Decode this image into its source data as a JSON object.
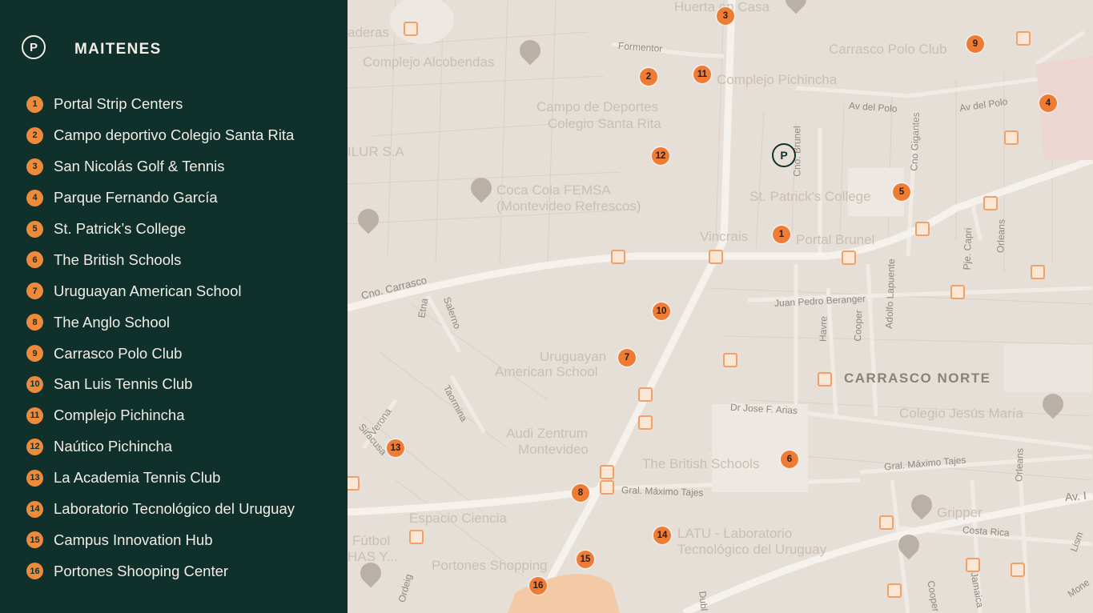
{
  "brand": {
    "logo_letter": "P",
    "name": "MAITENES"
  },
  "locations": [
    {
      "n": "1",
      "name": "Portal Strip Centers"
    },
    {
      "n": "2",
      "name": "Campo deportivo Colegio Santa Rita"
    },
    {
      "n": "3",
      "name": "San Nicolás Golf & Tennis"
    },
    {
      "n": "4",
      "name": "Parque Fernando García"
    },
    {
      "n": "5",
      "name": "St. Patrick’s College"
    },
    {
      "n": "6",
      "name": "The British Schools"
    },
    {
      "n": "7",
      "name": "Uruguayan American School"
    },
    {
      "n": "8",
      "name": "The Anglo School"
    },
    {
      "n": "9",
      "name": "Carrasco Polo Club"
    },
    {
      "n": "10",
      "name": "San Luis Tennis Club"
    },
    {
      "n": "11",
      "name": "Complejo Pichincha"
    },
    {
      "n": "12",
      "name": "Naútico Pichincha"
    },
    {
      "n": "13",
      "name": "La Academia Tennis Club"
    },
    {
      "n": "14",
      "name": "Laboratorio Tecnológico del Uruguay"
    },
    {
      "n": "15",
      "name": "Campus Innovation Hub"
    },
    {
      "n": "16",
      "name": "Portones Shooping Center"
    }
  ],
  "map": {
    "district": "CARRASCO NORTE",
    "project_marker": "P",
    "places": {
      "huerta": "Huerta en Casa",
      "maderas": "aderas",
      "alcobendas": "Complejo Alcobendas",
      "polo": "Carrasco Polo Club",
      "pichincha": "Complejo Pichincha",
      "campo1": "Campo de Deportes",
      "campo2": "Colegio Santa Rita",
      "ilur": "ILUR S.A",
      "coca1": "Coca Cola FEMSA",
      "coca2": "(Montevideo Refrescos)",
      "stpatrick": "St. Patrick's College",
      "vincrais": "Vincrais",
      "portal": "Portal Brunel",
      "uas1": "Uruguayan",
      "uas2": "American School",
      "audi1": "Audi Zentrum",
      "audi2": "Montevideo",
      "british": "The British Schools",
      "jesus": "Colegio Jesús María",
      "espacio": "Espacio Ciencia",
      "gripper": "Gripper",
      "latu1": "LATU - Laboratorio",
      "latu2": "Tecnológico del Uruguay",
      "portones": "Portones Shopping",
      "futbol1": "Fútbol",
      "futbol2": "HAS Y..."
    },
    "streets": {
      "formentor": "Formentor",
      "avpolo1": "Av del Polo",
      "avpolo2": "Av del Polo",
      "brunel": "Cno. Brunel",
      "gigantes": "Cno Gigantes",
      "carrasco": "Cno. Carrasco",
      "etna": "Etna",
      "salerno": "Salerno",
      "beranger": "Juan Pedro Beranger",
      "havre": "Havre",
      "cooper": "Cooper",
      "lapuente": "Adolfo Lapuente",
      "capri": "Pje. Capri",
      "orleans": "Orleans",
      "arias": "Dr Jose F. Arias",
      "taormina": "Taormina",
      "verona": "Verona",
      "siracusa": "Siracusa",
      "tajes1": "Gral. Máximo Tajes",
      "tajes2": "Gral. Máximo Tajes",
      "orleans2": "Orleans",
      "costarica": "Costa Rica",
      "av": "Av. I",
      "ordeig": "Ordeig",
      "cooper2": "Cooper",
      "jamaica": "Jamaica",
      "dub": "Dubl",
      "lisbon": "Lism",
      "mone": "Mone"
    },
    "markers": [
      {
        "n": "1"
      },
      {
        "n": "2"
      },
      {
        "n": "3"
      },
      {
        "n": "4"
      },
      {
        "n": "5"
      },
      {
        "n": "6"
      },
      {
        "n": "7"
      },
      {
        "n": "8"
      },
      {
        "n": "9"
      },
      {
        "n": "10"
      },
      {
        "n": "11"
      },
      {
        "n": "12"
      },
      {
        "n": "13"
      },
      {
        "n": "14"
      },
      {
        "n": "15"
      },
      {
        "n": "16"
      }
    ]
  }
}
